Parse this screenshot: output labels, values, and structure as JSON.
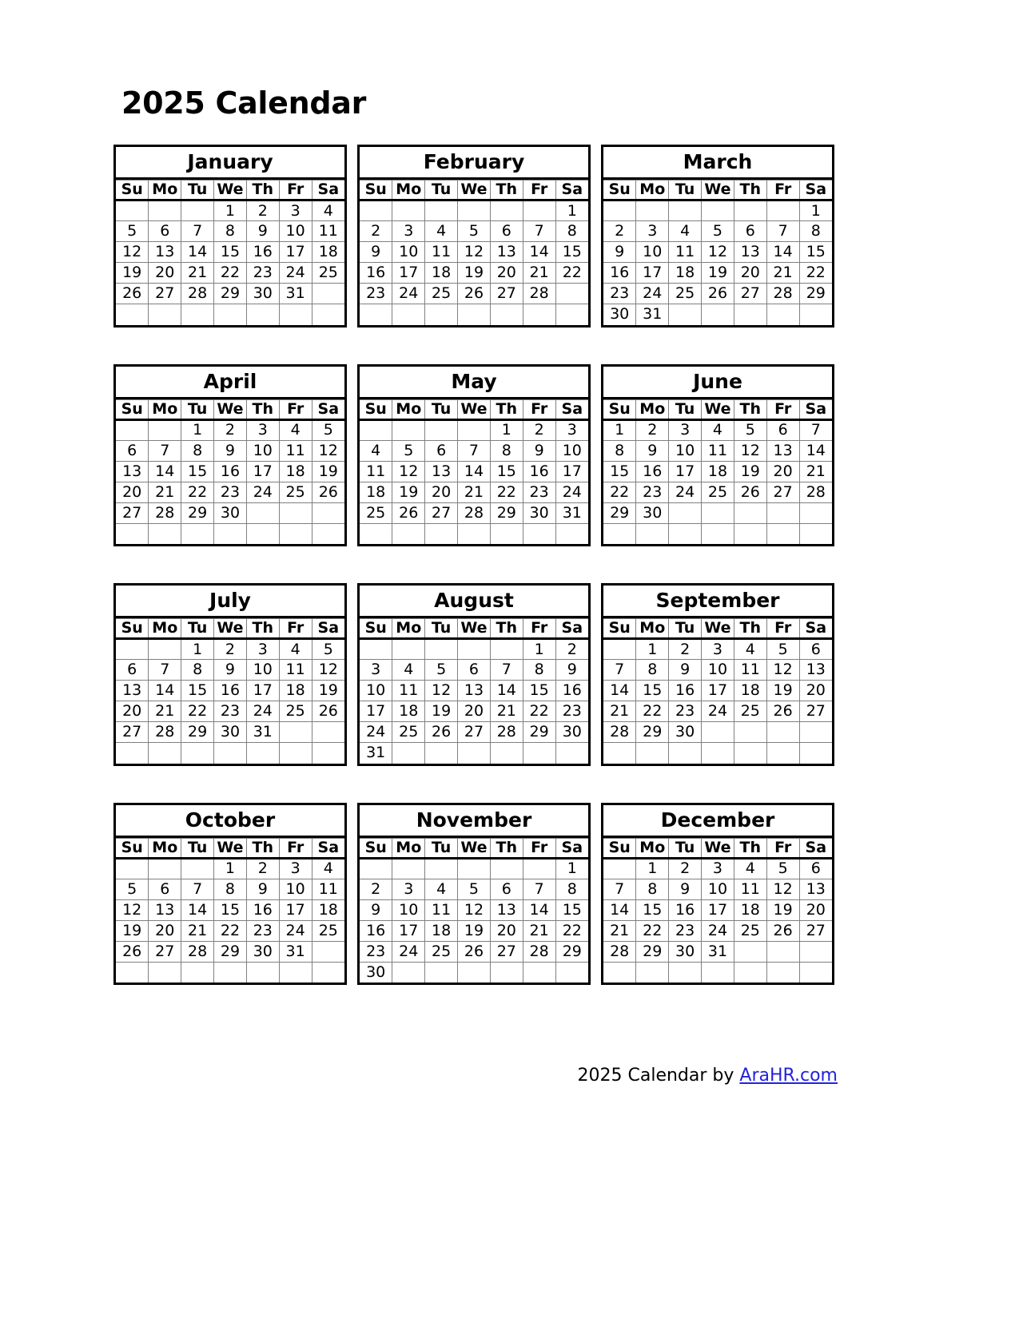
{
  "title": "2025 Calendar",
  "year": "2025",
  "weekdays": [
    "Su",
    "Mo",
    "Tu",
    "We",
    "Th",
    "Fr",
    "Sa"
  ],
  "footer": {
    "year": "2025",
    "text": "Calendar by",
    "link": "AraHR.com",
    "link_color": "#2222dd"
  },
  "colors": {
    "text": "#000000",
    "background": "#ffffff",
    "outer_border": "#000000",
    "grid_line": "#808080",
    "link": "#2222dd"
  },
  "months": [
    {
      "name": "January",
      "weeks": [
        [
          "",
          "",
          "",
          "1",
          "2",
          "3",
          "4"
        ],
        [
          "5",
          "6",
          "7",
          "8",
          "9",
          "10",
          "11"
        ],
        [
          "12",
          "13",
          "14",
          "15",
          "16",
          "17",
          "18"
        ],
        [
          "19",
          "20",
          "21",
          "22",
          "23",
          "24",
          "25"
        ],
        [
          "26",
          "27",
          "28",
          "29",
          "30",
          "31",
          ""
        ],
        [
          "",
          "",
          "",
          "",
          "",
          "",
          ""
        ]
      ]
    },
    {
      "name": "February",
      "weeks": [
        [
          "",
          "",
          "",
          "",
          "",
          "",
          "1"
        ],
        [
          "2",
          "3",
          "4",
          "5",
          "6",
          "7",
          "8"
        ],
        [
          "9",
          "10",
          "11",
          "12",
          "13",
          "14",
          "15"
        ],
        [
          "16",
          "17",
          "18",
          "19",
          "20",
          "21",
          "22"
        ],
        [
          "23",
          "24",
          "25",
          "26",
          "27",
          "28",
          ""
        ],
        [
          "",
          "",
          "",
          "",
          "",
          "",
          ""
        ]
      ]
    },
    {
      "name": "March",
      "weeks": [
        [
          "",
          "",
          "",
          "",
          "",
          "",
          "1"
        ],
        [
          "2",
          "3",
          "4",
          "5",
          "6",
          "7",
          "8"
        ],
        [
          "9",
          "10",
          "11",
          "12",
          "13",
          "14",
          "15"
        ],
        [
          "16",
          "17",
          "18",
          "19",
          "20",
          "21",
          "22"
        ],
        [
          "23",
          "24",
          "25",
          "26",
          "27",
          "28",
          "29"
        ],
        [
          "30",
          "31",
          "",
          "",
          "",
          "",
          ""
        ]
      ]
    },
    {
      "name": "April",
      "weeks": [
        [
          "",
          "",
          "1",
          "2",
          "3",
          "4",
          "5"
        ],
        [
          "6",
          "7",
          "8",
          "9",
          "10",
          "11",
          "12"
        ],
        [
          "13",
          "14",
          "15",
          "16",
          "17",
          "18",
          "19"
        ],
        [
          "20",
          "21",
          "22",
          "23",
          "24",
          "25",
          "26"
        ],
        [
          "27",
          "28",
          "29",
          "30",
          "",
          "",
          ""
        ],
        [
          "",
          "",
          "",
          "",
          "",
          "",
          ""
        ]
      ]
    },
    {
      "name": "May",
      "weeks": [
        [
          "",
          "",
          "",
          "",
          "1",
          "2",
          "3"
        ],
        [
          "4",
          "5",
          "6",
          "7",
          "8",
          "9",
          "10"
        ],
        [
          "11",
          "12",
          "13",
          "14",
          "15",
          "16",
          "17"
        ],
        [
          "18",
          "19",
          "20",
          "21",
          "22",
          "23",
          "24"
        ],
        [
          "25",
          "26",
          "27",
          "28",
          "29",
          "30",
          "31"
        ],
        [
          "",
          "",
          "",
          "",
          "",
          "",
          ""
        ]
      ]
    },
    {
      "name": "June",
      "weeks": [
        [
          "1",
          "2",
          "3",
          "4",
          "5",
          "6",
          "7"
        ],
        [
          "8",
          "9",
          "10",
          "11",
          "12",
          "13",
          "14"
        ],
        [
          "15",
          "16",
          "17",
          "18",
          "19",
          "20",
          "21"
        ],
        [
          "22",
          "23",
          "24",
          "25",
          "26",
          "27",
          "28"
        ],
        [
          "29",
          "30",
          "",
          "",
          "",
          "",
          ""
        ],
        [
          "",
          "",
          "",
          "",
          "",
          "",
          ""
        ]
      ]
    },
    {
      "name": "July",
      "weeks": [
        [
          "",
          "",
          "1",
          "2",
          "3",
          "4",
          "5"
        ],
        [
          "6",
          "7",
          "8",
          "9",
          "10",
          "11",
          "12"
        ],
        [
          "13",
          "14",
          "15",
          "16",
          "17",
          "18",
          "19"
        ],
        [
          "20",
          "21",
          "22",
          "23",
          "24",
          "25",
          "26"
        ],
        [
          "27",
          "28",
          "29",
          "30",
          "31",
          "",
          ""
        ],
        [
          "",
          "",
          "",
          "",
          "",
          "",
          ""
        ]
      ]
    },
    {
      "name": "August",
      "weeks": [
        [
          "",
          "",
          "",
          "",
          "",
          "1",
          "2"
        ],
        [
          "3",
          "4",
          "5",
          "6",
          "7",
          "8",
          "9"
        ],
        [
          "10",
          "11",
          "12",
          "13",
          "14",
          "15",
          "16"
        ],
        [
          "17",
          "18",
          "19",
          "20",
          "21",
          "22",
          "23"
        ],
        [
          "24",
          "25",
          "26",
          "27",
          "28",
          "29",
          "30"
        ],
        [
          "31",
          "",
          "",
          "",
          "",
          "",
          ""
        ]
      ]
    },
    {
      "name": "September",
      "weeks": [
        [
          "",
          "1",
          "2",
          "3",
          "4",
          "5",
          "6"
        ],
        [
          "7",
          "8",
          "9",
          "10",
          "11",
          "12",
          "13"
        ],
        [
          "14",
          "15",
          "16",
          "17",
          "18",
          "19",
          "20"
        ],
        [
          "21",
          "22",
          "23",
          "24",
          "25",
          "26",
          "27"
        ],
        [
          "28",
          "29",
          "30",
          "",
          "",
          "",
          ""
        ],
        [
          "",
          "",
          "",
          "",
          "",
          "",
          ""
        ]
      ]
    },
    {
      "name": "October",
      "weeks": [
        [
          "",
          "",
          "",
          "1",
          "2",
          "3",
          "4"
        ],
        [
          "5",
          "6",
          "7",
          "8",
          "9",
          "10",
          "11"
        ],
        [
          "12",
          "13",
          "14",
          "15",
          "16",
          "17",
          "18"
        ],
        [
          "19",
          "20",
          "21",
          "22",
          "23",
          "24",
          "25"
        ],
        [
          "26",
          "27",
          "28",
          "29",
          "30",
          "31",
          ""
        ],
        [
          "",
          "",
          "",
          "",
          "",
          "",
          ""
        ]
      ]
    },
    {
      "name": "November",
      "weeks": [
        [
          "",
          "",
          "",
          "",
          "",
          "",
          "1"
        ],
        [
          "2",
          "3",
          "4",
          "5",
          "6",
          "7",
          "8"
        ],
        [
          "9",
          "10",
          "11",
          "12",
          "13",
          "14",
          "15"
        ],
        [
          "16",
          "17",
          "18",
          "19",
          "20",
          "21",
          "22"
        ],
        [
          "23",
          "24",
          "25",
          "26",
          "27",
          "28",
          "29"
        ],
        [
          "30",
          "",
          "",
          "",
          "",
          "",
          ""
        ]
      ]
    },
    {
      "name": "December",
      "weeks": [
        [
          "",
          "1",
          "2",
          "3",
          "4",
          "5",
          "6"
        ],
        [
          "7",
          "8",
          "9",
          "10",
          "11",
          "12",
          "13"
        ],
        [
          "14",
          "15",
          "16",
          "17",
          "18",
          "19",
          "20"
        ],
        [
          "21",
          "22",
          "23",
          "24",
          "25",
          "26",
          "27"
        ],
        [
          "28",
          "29",
          "30",
          "31",
          "",
          "",
          ""
        ],
        [
          "",
          "",
          "",
          "",
          "",
          "",
          ""
        ]
      ]
    }
  ]
}
